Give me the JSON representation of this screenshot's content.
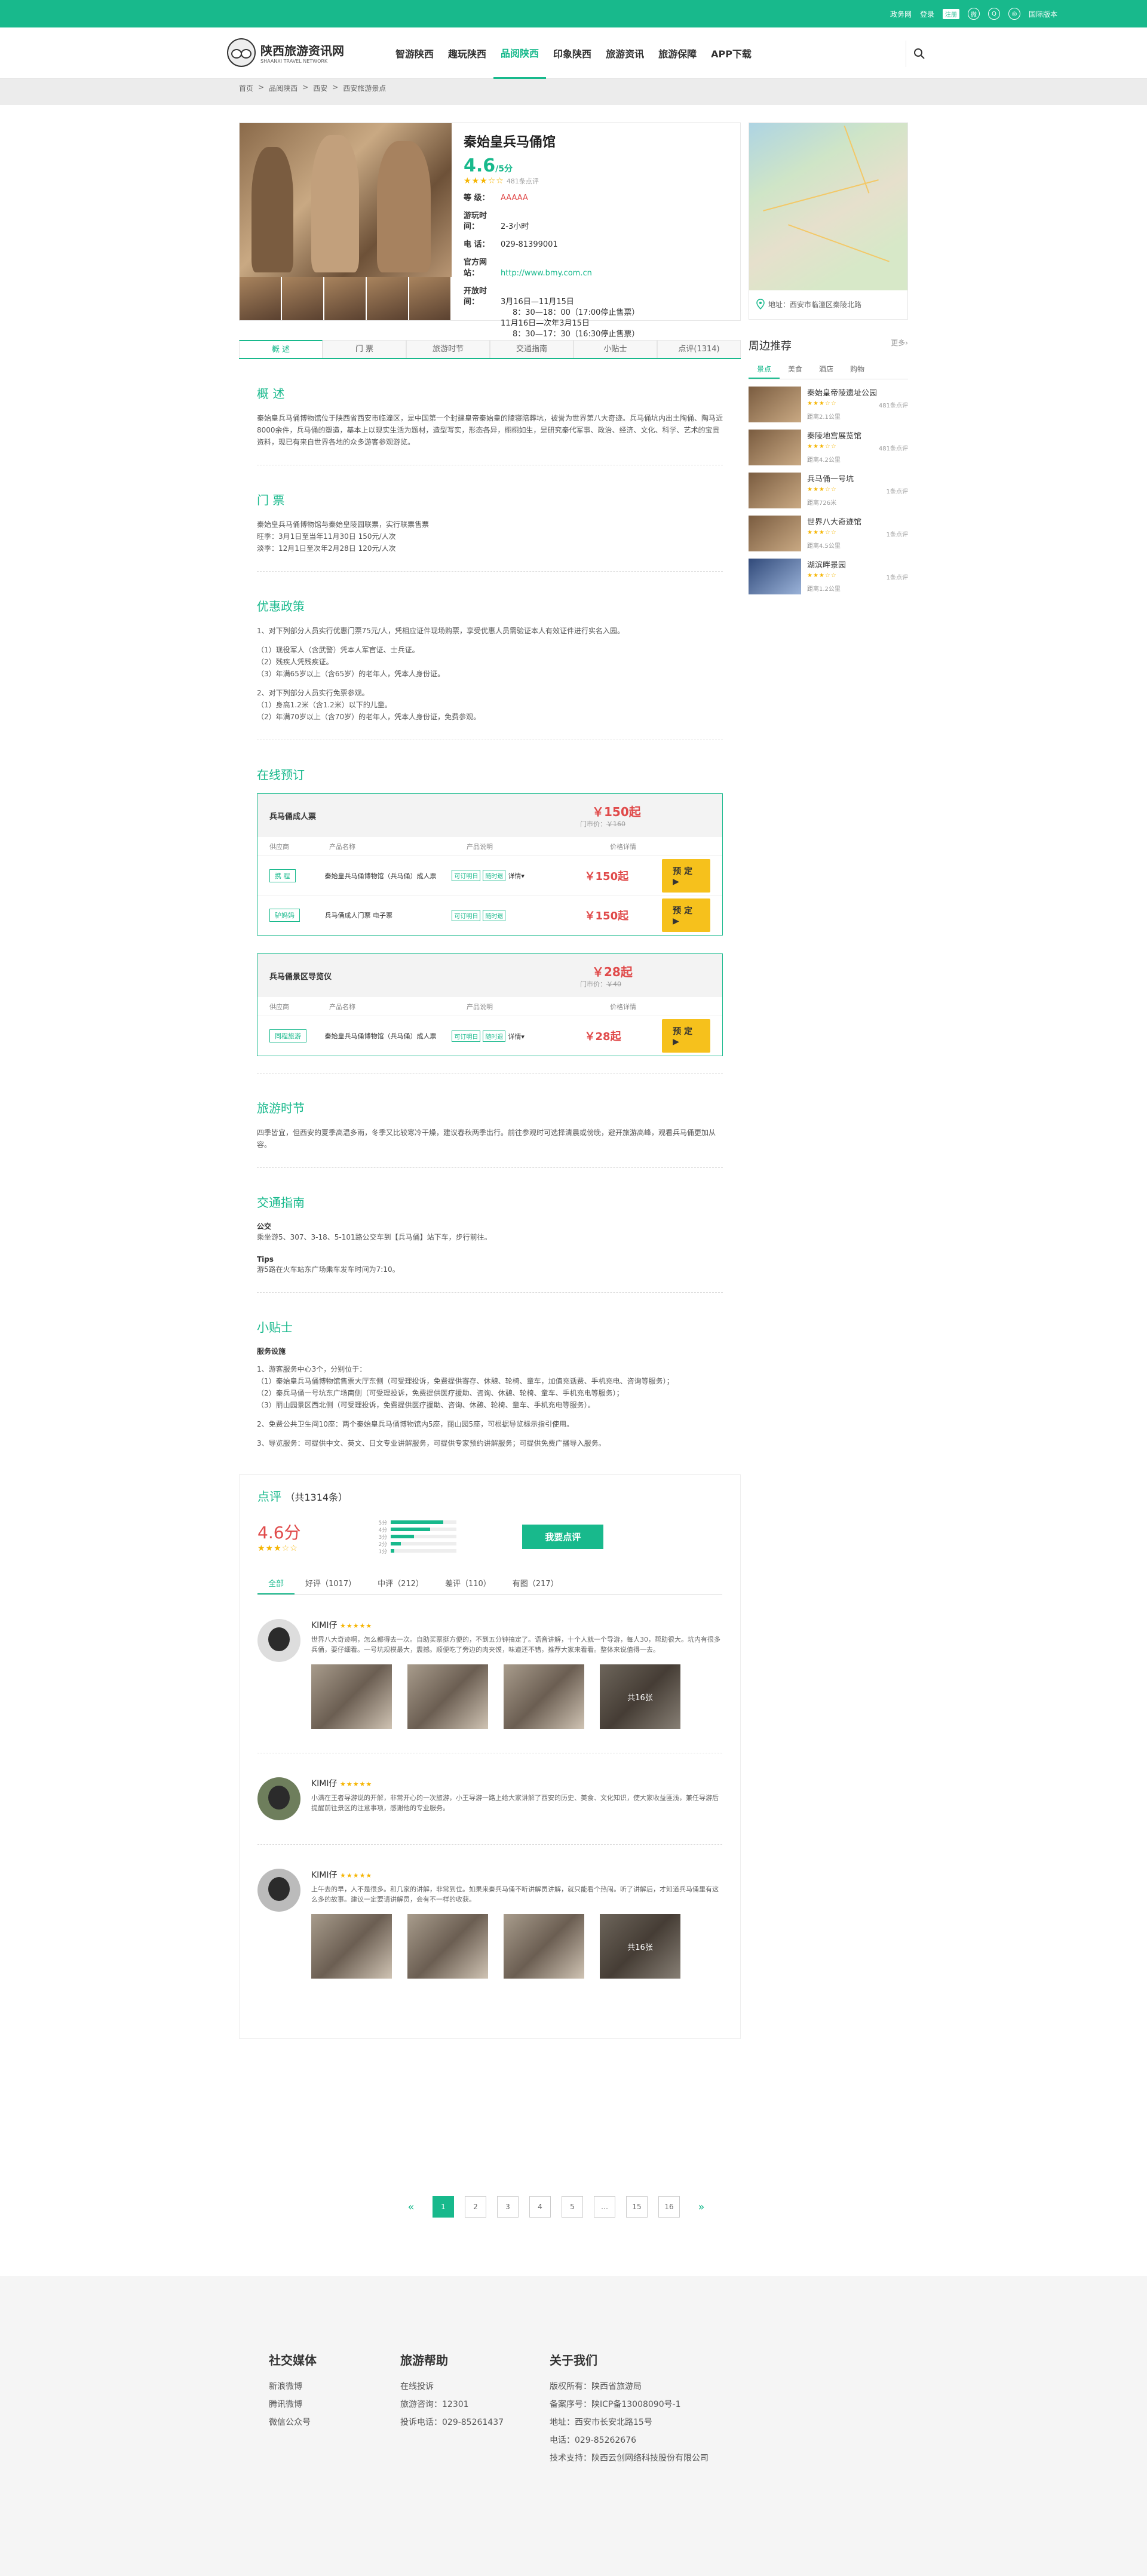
{
  "topbar": {
    "links": [
      "政务网",
      "登录",
      "注册"
    ],
    "lang": "国际版本"
  },
  "logo": {
    "cn": "陕西旅游资讯网",
    "en": "SHAANXI TRAVEL NETWORK"
  },
  "nav": [
    "智游陕西",
    "趣玩陕西",
    "品阅陕西",
    "印象陕西",
    "旅游资讯",
    "旅游保障",
    "APP下载"
  ],
  "breadcrumbs": [
    "首页",
    ">",
    "品阅陕西",
    ">",
    "西安",
    ">",
    "西安旅游景点"
  ],
  "attraction": {
    "name": "秦始皇兵马俑馆",
    "score": "4.6",
    "score_unit": "/5分",
    "stars": "★★★☆☆",
    "reviews_count": "481条点评",
    "rows": [
      {
        "k": "等 级：",
        "v": "AAAAA"
      },
      {
        "k": "游玩时间：",
        "v": "2-3小时"
      },
      {
        "k": "电 话：",
        "v": "029-81399001"
      },
      {
        "k": "官方网站：",
        "v": "http://www.bmy.com.cn"
      }
    ],
    "hours_label": "开放时间：",
    "hours": [
      "3月16日—11月15日",
      "8：30—18：00（17:00停止售票）",
      "11月16日—次年3月15日",
      "8：30—17：30（16:30停止售票）"
    ]
  },
  "map": {
    "address": "地址：西安市临潼区秦陵北路"
  },
  "tabs": [
    "概 述",
    "门 票",
    "旅游时节",
    "交通指南",
    "小贴士",
    "点评(1314)"
  ],
  "overview": {
    "title": "概 述",
    "text": "秦始皇兵马俑博物馆位于陕西省西安市临潼区，是中国第一个封建皇帝秦始皇的陵寝陪葬坑，被誉为世界第八大奇迹。兵马俑坑内出土陶俑、陶马近8000余件，兵马俑的塑造，基本上以现实生活为题材，造型写实，形态各异，栩栩如生，是研究秦代军事、政治、经济、文化、科学、艺术的宝贵资料，现已有来自世界各地的众多游客参观游览。"
  },
  "ticket": {
    "title": "门 票",
    "lines": [
      "秦始皇兵马俑博物馆与秦始皇陵园联票，实行联票售票",
      "旺季：3月1日至当年11月30日 150元/人次",
      "淡季：12月1日至次年2月28日 120元/人次"
    ]
  },
  "policy": {
    "title": "优惠政策",
    "groups": [
      [
        "1、对下列部分人员实行优惠门票75元/人，凭相应证件现场购票，享受优惠人员需验证本人有效证件进行实名入园。"
      ],
      [
        "（1）现役军人（含武警）凭本人军官证、士兵证。",
        "（2）残疾人凭残疾证。",
        "（3）年满65岁以上（含65岁）的老年人，凭本人身份证。"
      ],
      [
        "2、对下列部分人员实行免票参观。",
        "（1）身高1.2米（含1.2米）以下的儿童。",
        "（2）年满70岁以上（含70岁）的老年人，凭本人身份证，免费参观。"
      ]
    ]
  },
  "online": {
    "title": "在线预订",
    "packages": [
      {
        "name": "兵马俑成人票",
        "price": "￥150起",
        "orig_label": "门市价：",
        "orig": "￥160",
        "cols": [
          "供应商",
          "产品名称",
          "产品说明",
          "价格详情"
        ],
        "rows": [
          {
            "vendor": "携 程",
            "product": "秦始皇兵马俑博物馆（兵马俑）成人票",
            "tags": [
              "可订明日",
              "随时退"
            ],
            "detail": "详情▾",
            "price": "￥150起",
            "btn": "预 定"
          },
          {
            "vendor": "驴妈妈",
            "product": "兵马俑成人门票 电子票",
            "tags": [
              "可订明日",
              "随时退"
            ],
            "detail": "",
            "price": "￥150起",
            "btn": "预 定"
          }
        ]
      },
      {
        "name": "兵马俑景区导览仪",
        "price": "￥28起",
        "orig_label": "门市价：",
        "orig": "￥40",
        "cols": [
          "供应商",
          "产品名称",
          "产品说明",
          "价格详情"
        ],
        "rows": [
          {
            "vendor": "同程旅游",
            "product": "秦始皇兵马俑博物馆（兵马俑）成人票",
            "tags": [
              "可订明日",
              "随时退"
            ],
            "detail": "详情▾",
            "price": "￥28起",
            "btn": "预 定"
          }
        ]
      }
    ]
  },
  "season": {
    "title": "旅游时节",
    "text": "四季皆宜，但西安的夏季高温多雨，冬季又比较寒冷干燥，建议春秋两季出行。前往参观时可选择清晨或傍晚，避开旅游高峰，观看兵马俑更加从容。"
  },
  "traffic": {
    "title": "交通指南",
    "bus_label": "公交",
    "bus": "乘坐游5、307、3-18、5-101路公交车到【兵马俑】站下车，步行前往。",
    "tips_label": "Tips",
    "tips": "游5路在火车站东广场乘车发车时间为7:10。"
  },
  "tips": {
    "title": "小贴士",
    "sub": "服务设施",
    "lines": [
      "1、游客服务中心3个，分别位于：",
      "（1）秦始皇兵马俑博物馆售票大厅东侧（可受理投诉，免费提供寄存、休憩、轮椅、童车，加值充话费、手机充电、咨询等服务）；",
      "（2）秦兵马俑一号坑东广场南侧（可受理投诉，免费提供医疗援助、咨询、休憩、轮椅、童车、手机充电等服务）；",
      "（3）丽山园景区西北侧（可受理投诉，免费提供医疗援助、咨询、休憩、轮椅、童车、手机充电等服务）。",
      "2、免费公共卫生间10座：两个秦始皇兵马俑博物馆内5座，丽山园5座，可根据导览标示指引使用。",
      "3、导览服务：可提供中文、英文、日文专业讲解服务，可提供专家预约讲解服务；可提供免费广播导入服务。"
    ]
  },
  "review": {
    "title": "点评",
    "count": "（共1314条）",
    "score": "4.6分",
    "stars": "★★★☆☆",
    "levels": [
      {
        "l": "5分",
        "p": 0.8
      },
      {
        "l": "4分",
        "p": 0.6
      },
      {
        "l": "3分",
        "p": 0.35
      },
      {
        "l": "2分",
        "p": 0.15
      },
      {
        "l": "1分",
        "p": 0.05
      }
    ],
    "btn": "我要点评",
    "tabs": [
      "全部",
      "好评（1017）",
      "中评（212）",
      "差评（110）",
      "有图（217）"
    ],
    "items": [
      {
        "name": "KIMI仔",
        "stars": "★★★★★",
        "text": "世界八大奇迹啊，怎么都得去一次。自助买票挺方便的，不到五分钟搞定了。语音讲解，十个人就一个导游，每人30，帮助很大。坑内有很多兵俑，要仔细看。一号坑规模最大，震撼。顺便吃了旁边的肉夹馍，味道还不错，推荐大家来看看。整体来说值得一去。",
        "photos": [
          "",
          "",
          "",
          "共16张"
        ]
      },
      {
        "name": "KIMI仔",
        "stars": "★★★★★",
        "text": "小满在王者导游说的开解，非常开心的一次旅游，小王导游一路上给大家讲解了西安的历史、美食、文化知识，使大家收益匪浅，兼任导游后提醒前往景区的注意事项，感谢他的专业服务。",
        "photos": []
      },
      {
        "name": "KIMI仔",
        "stars": "★★★★★",
        "text": "上午去的早，人不是很多。和几家的讲解，非常到位。如果来秦兵马俑不听讲解员讲解，就只能看个热闹。听了讲解后，才知道兵马俑里有这么多的故事。建议一定要请讲解员，会有不一样的收获。",
        "photos": [
          "",
          "",
          "",
          "共16张"
        ]
      }
    ]
  },
  "pager": {
    "prev": "«",
    "pages": [
      "1",
      "2",
      "3",
      "4",
      "5",
      "…",
      "15",
      "16"
    ],
    "next": "»"
  },
  "sidebar": {
    "title": "周边推荐",
    "more": "更多›",
    "tabs": [
      "景点",
      "美食",
      "酒店",
      "购物"
    ],
    "items": [
      {
        "name": "秦始皇帝陵遗址公园",
        "stars": "★★★☆☆",
        "reviews": "481条点评",
        "dist": "距离2.1公里"
      },
      {
        "name": "秦陵地宫展览馆",
        "stars": "★★★☆☆",
        "reviews": "481条点评",
        "dist": "距离4.2公里"
      },
      {
        "name": "兵马俑一号坑",
        "stars": "★★★☆☆",
        "reviews": "1条点评",
        "dist": "距离726米"
      },
      {
        "name": "世界八大奇迹馆",
        "stars": "★★★☆☆",
        "reviews": "1条点评",
        "dist": "距离4.5公里"
      },
      {
        "name": "湖滨畔景园",
        "stars": "★★★☆☆",
        "reviews": "1条点评",
        "dist": "距离1.2公里"
      }
    ]
  },
  "footer": {
    "cols": [
      {
        "title": "社交媒体",
        "items": [
          "新浪微博",
          "腾讯微博",
          "微信公众号"
        ]
      },
      {
        "title": "旅游帮助",
        "items": [
          "在线投诉",
          "旅游咨询：12301",
          "投诉电话：029-85261437"
        ]
      },
      {
        "title": "关于我们",
        "items": [
          "版权所有：陕西省旅游局",
          "备案序号：陕ICP备13008090号-1",
          "地址：西安市长安北路15号",
          "电话：029-85262676",
          "技术支持：陕西云创网络科技股份有限公司"
        ]
      }
    ]
  }
}
